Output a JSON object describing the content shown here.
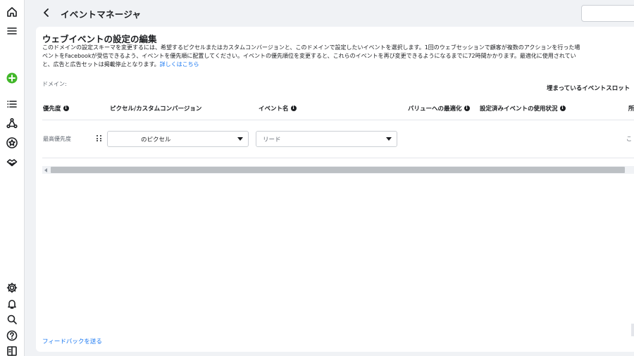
{
  "app": {
    "title": "イベントマネージャ"
  },
  "page": {
    "title": "ウェブイベントの設定の編集",
    "description_line1": "このドメインの設定スキーマを変更するには、希望するピクセルまたはカスタムコンバージョンと、このドメインで設定したいイベントを選択します。1回のウェブセッションで顧客が複数のアクションを行った場",
    "description_line2": "ベントをFacebookが受信できるよう、イベントを優先順に配置してください。イベントの優先順位を変更すると、これらのイベントを再び変更できるようになるまでに72時間かかります。最適化に使用されてい",
    "description_line3": "と、広告と広告セットは掲載停止となります。",
    "learn_more": "詳しくはこちら",
    "domain_label": "ドメイン:",
    "slots_label": "埋まっているイベントスロット"
  },
  "table": {
    "headers": [
      "優先度",
      "ピクセル/カスタムコンバージョン",
      "イベント名",
      "バリューへの最適化",
      "設定済みイベントの使用状況",
      "所"
    ],
    "info_icons": [
      true,
      false,
      true,
      true,
      true,
      false
    ],
    "rows": [
      {
        "priority": "最高優先度",
        "pixel": "のピクセル",
        "event": "リード",
        "right_text": "こ"
      }
    ]
  },
  "footer": {
    "feedback": "フィードバックを送る"
  },
  "sidebar": {
    "icons": [
      "home-icon",
      "menu-icon",
      "add-icon",
      "list-icon",
      "connections-icon",
      "star-icon",
      "partner-icon",
      "settings-icon",
      "bell-icon",
      "search-icon",
      "help-icon",
      "panel-icon"
    ]
  },
  "colors": {
    "accent": "#1877f2",
    "add_green": "#42b72a",
    "scrollbar_thumb": "#bcc0c4"
  }
}
